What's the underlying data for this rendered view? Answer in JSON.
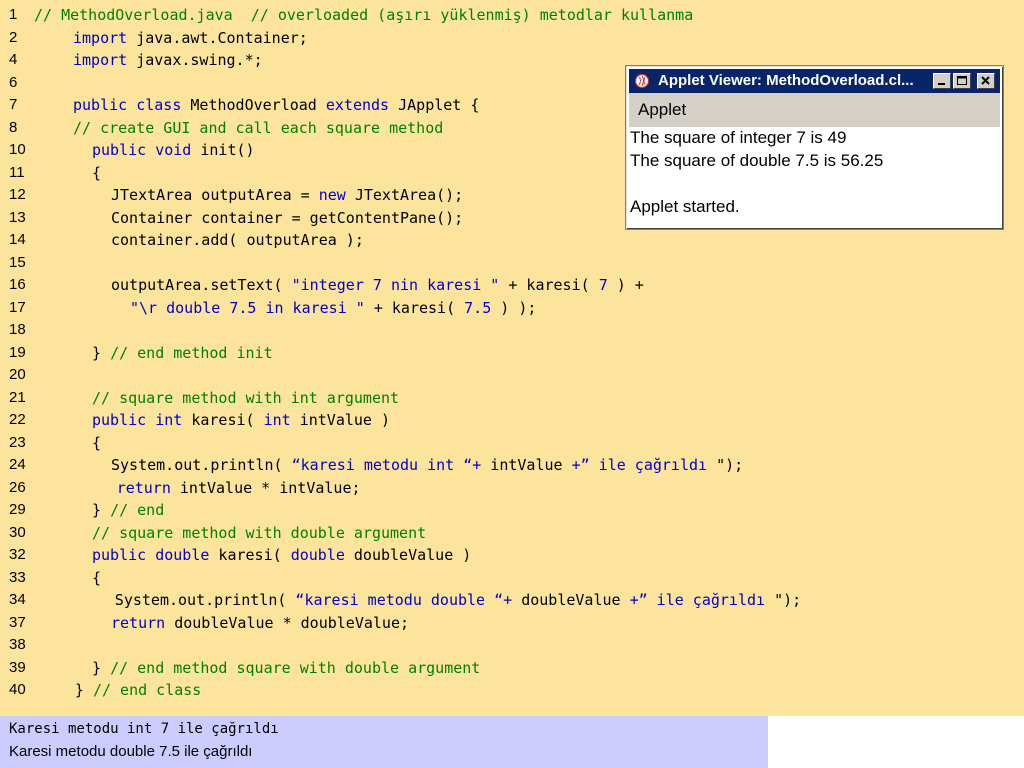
{
  "code_lines": [
    {
      "num": "1",
      "indent": 0,
      "tokens": [
        [
          "cm",
          "// MethodOverload.java  // overloaded (aşırı yüklenmiş) metodlar kullanma"
        ]
      ]
    },
    {
      "num": "2",
      "indent": 1,
      "tokens": [
        [
          "kw",
          "import"
        ],
        [
          "pl",
          " java.awt.Container;"
        ]
      ]
    },
    {
      "num": "4",
      "indent": 1,
      "tokens": [
        [
          "kw",
          "import"
        ],
        [
          "pl",
          " javax.swing.*;"
        ]
      ]
    },
    {
      "num": "6",
      "indent": 1,
      "tokens": []
    },
    {
      "num": "7",
      "indent": 1,
      "tokens": [
        [
          "kw",
          "public class"
        ],
        [
          "pl",
          " MethodOverload "
        ],
        [
          "kw",
          "extends"
        ],
        [
          "pl",
          " JApplet {"
        ]
      ]
    },
    {
      "num": "8",
      "indent": 1,
      "tokens": [
        [
          "cm",
          "// create GUI and call each square method"
        ]
      ]
    },
    {
      "num": "10",
      "indent": 2,
      "tokens": [
        [
          "kw",
          "public void"
        ],
        [
          "pl",
          " init()"
        ]
      ]
    },
    {
      "num": "11",
      "indent": 2,
      "tokens": [
        [
          "pl",
          "{"
        ]
      ]
    },
    {
      "num": "12",
      "indent": 3,
      "tokens": [
        [
          "pl",
          "JTextArea outputArea = "
        ],
        [
          "kw",
          "new"
        ],
        [
          "pl",
          " JTextArea();"
        ]
      ]
    },
    {
      "num": "13",
      "indent": 3,
      "tokens": [
        [
          "pl",
          "Container container = getContentPane();"
        ]
      ]
    },
    {
      "num": "14",
      "indent": 3,
      "tokens": [
        [
          "pl",
          "container.add( outputArea );"
        ]
      ]
    },
    {
      "num": "15",
      "indent": 3,
      "tokens": []
    },
    {
      "num": "16",
      "indent": 3,
      "tokens": [
        [
          "pl",
          "outputArea.setText( "
        ],
        [
          "st",
          "\"integer 7 nin karesi \""
        ],
        [
          "pl",
          " + karesi( "
        ],
        [
          "nm",
          "7"
        ],
        [
          "pl",
          " ) +"
        ]
      ]
    },
    {
      "num": "17",
      "indent": 4,
      "tokens": [
        [
          "st",
          "\"\\r double 7.5 in karesi \""
        ],
        [
          "pl",
          " + karesi( "
        ],
        [
          "nm",
          "7.5"
        ],
        [
          "pl",
          " ) );"
        ]
      ]
    },
    {
      "num": "18",
      "indent": 3,
      "tokens": []
    },
    {
      "num": "19",
      "indent": 2,
      "tokens": [
        [
          "pl",
          "} "
        ],
        [
          "cm",
          "// end method init"
        ]
      ]
    },
    {
      "num": "20",
      "indent": 2,
      "tokens": []
    },
    {
      "num": "21",
      "indent": 2,
      "tokens": [
        [
          "cm",
          "// square method with int argument"
        ]
      ]
    },
    {
      "num": "22",
      "indent": 2,
      "tokens": [
        [
          "kw",
          "public int"
        ],
        [
          "pl",
          " karesi( "
        ],
        [
          "kw",
          "int"
        ],
        [
          "pl",
          " intValue )"
        ]
      ]
    },
    {
      "num": "23",
      "indent": 2,
      "tokens": [
        [
          "pl",
          "{"
        ]
      ]
    },
    {
      "num": "24",
      "indent": 3,
      "tokens": [
        [
          "pl",
          "System.out.println( "
        ],
        [
          "st",
          "“karesi metodu int “+"
        ],
        [
          "pl",
          " intValue "
        ],
        [
          "st",
          "+” ile çağrıldı "
        ],
        [
          "pl",
          "\");"
        ]
      ]
    },
    {
      "num": "26",
      "indent": 3.3,
      "tokens": [
        [
          "kw",
          "return"
        ],
        [
          "pl",
          " intValue * intValue;"
        ]
      ]
    },
    {
      "num": "29",
      "indent": 2,
      "tokens": [
        [
          "pl",
          "} "
        ],
        [
          "cm",
          "// end"
        ]
      ]
    },
    {
      "num": "30",
      "indent": 2,
      "tokens": [
        [
          "cm",
          "// square method with double argument"
        ]
      ]
    },
    {
      "num": "32",
      "indent": 2,
      "tokens": [
        [
          "kw",
          "public double"
        ],
        [
          "pl",
          " karesi( "
        ],
        [
          "kw",
          "double"
        ],
        [
          "pl",
          " doubleValue )"
        ]
      ]
    },
    {
      "num": "33",
      "indent": 2,
      "tokens": [
        [
          "pl",
          "{"
        ]
      ]
    },
    {
      "num": "34",
      "indent": 3.2,
      "tokens": [
        [
          "pl",
          "System.out.println( "
        ],
        [
          "st",
          "“karesi metodu double “+"
        ],
        [
          "pl",
          " doubleValue "
        ],
        [
          "st",
          "+” ile çağrıldı "
        ],
        [
          "pl",
          "\");"
        ]
      ]
    },
    {
      "num": "37",
      "indent": 3,
      "tokens": [
        [
          "kw",
          "return"
        ],
        [
          "pl",
          " doubleValue * doubleValue;"
        ]
      ]
    },
    {
      "num": "38",
      "indent": 3,
      "tokens": []
    },
    {
      "num": "39",
      "indent": 2,
      "tokens": [
        [
          "pl",
          "} "
        ],
        [
          "cm",
          "// end method square with double argument"
        ]
      ]
    },
    {
      "num": "40",
      "indent": 1.1,
      "tokens": [
        [
          "pl",
          "} "
        ],
        [
          "cm",
          "// end class"
        ]
      ]
    }
  ],
  "applet_window": {
    "title": "Applet Viewer: MethodOverload.cl...",
    "menu_label": "Applet",
    "output_lines": [
      "The square of integer 7 is 49",
      "The square of double 7.5 is 56.25",
      "",
      "Applet started."
    ]
  },
  "console_output": {
    "line1": "Karesi metodu int 7 ile çağrıldı",
    "line2": "Karesi metodu double 7.5 ile çağrıldı"
  },
  "colors": {
    "slide_background": "#fde49c",
    "keyword": "#0000cc",
    "comment": "#008000",
    "console_background": "#ccccff",
    "titlebar": "#0a246a"
  }
}
